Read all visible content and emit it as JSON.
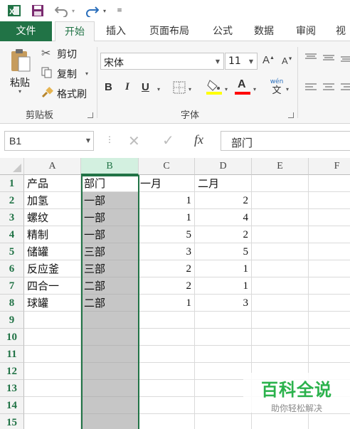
{
  "qat": {
    "app_icon": "excel-logo-icon",
    "save_icon": "save-icon",
    "undo_icon": "undo-icon",
    "redo_icon": "redo-icon",
    "customize_icon": "customize-qat-icon"
  },
  "tabs": [
    "文件",
    "开始",
    "插入",
    "页面布局",
    "公式",
    "数据",
    "审阅",
    "视图"
  ],
  "active_tab": "开始",
  "clipboard": {
    "paste": "粘贴",
    "cut": "剪切",
    "copy": "复制",
    "format_painter": "格式刷",
    "group_label": "剪贴板"
  },
  "font": {
    "name": "宋体",
    "size": "11",
    "group_label": "字体",
    "bold": "B",
    "italic": "I",
    "underline": "U",
    "phonetic_top": "wén",
    "phonetic_bottom": "文"
  },
  "formula_bar": {
    "name_box": "B1",
    "cancel_icon": "cancel-x-icon",
    "enter_icon": "enter-check-icon",
    "fx": "fx",
    "content": "部门"
  },
  "columns": [
    "A",
    "B",
    "C",
    "D",
    "E",
    "F"
  ],
  "rows": [
    "1",
    "2",
    "3",
    "4",
    "5",
    "6",
    "7",
    "8",
    "9",
    "10",
    "11",
    "12",
    "13",
    "14",
    "15"
  ],
  "table": {
    "headers": [
      "产品",
      "部门",
      "一月",
      "二月"
    ],
    "rows": [
      [
        "加氢",
        "一部",
        "1",
        "2"
      ],
      [
        "螺纹",
        "一部",
        "1",
        "4"
      ],
      [
        "精制",
        "一部",
        "5",
        "2"
      ],
      [
        "储罐",
        "三部",
        "3",
        "5"
      ],
      [
        "反应釜",
        "三部",
        "2",
        "1"
      ],
      [
        "四合一",
        "二部",
        "2",
        "1"
      ],
      [
        "球罐",
        "二部",
        "1",
        "3"
      ]
    ]
  },
  "watermark": {
    "title": "百科全说",
    "subtitle": "助你轻松解决"
  },
  "colors": {
    "accent": "#217346",
    "selection_fill": "#c6c6c6",
    "watermark_green": "#2bb24c"
  }
}
